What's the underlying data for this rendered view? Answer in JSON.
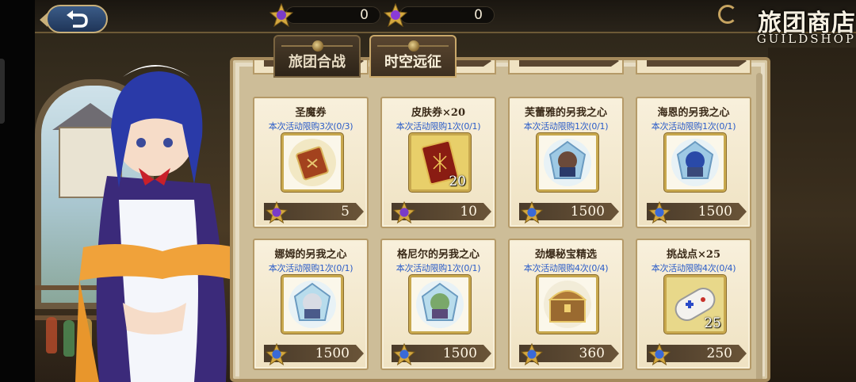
{
  "header": {
    "back_label": "↩",
    "currency": [
      {
        "icon": "purple-gold-star-gem-icon",
        "amount": "0"
      },
      {
        "icon": "purple-gold-star-gem-icon",
        "amount": "0"
      }
    ],
    "title_cn": "旅团商店",
    "title_en": "GUILDSHOP"
  },
  "tabs": [
    {
      "label": "旅团合战",
      "active": false
    },
    {
      "label": "时空远征",
      "active": true
    }
  ],
  "items": [
    {
      "name": "圣魔券",
      "limit": "本次活动限购3次(0/3)",
      "qty": "",
      "price": "5",
      "icon": "red-ticket-icon"
    },
    {
      "name": "皮肤券×20",
      "limit": "本次活动限购1次(0/1)",
      "qty": "20",
      "price": "10",
      "icon": "skin-ticket-icon"
    },
    {
      "name": "芙蕾雅的另我之心",
      "limit": "本次活动限购1次(0/1)",
      "qty": "",
      "price": "1500",
      "icon": "crystal-heart-portrait-icon"
    },
    {
      "name": "海恩的另我之心",
      "limit": "本次活动限购1次(0/1)",
      "qty": "",
      "price": "1500",
      "icon": "crystal-heart-portrait-icon"
    },
    {
      "name": "娜姆的另我之心",
      "limit": "本次活动限购1次(0/1)",
      "qty": "",
      "price": "1500",
      "icon": "crystal-heart-portrait-icon"
    },
    {
      "name": "格尼尔的另我之心",
      "limit": "本次活动限购1次(0/1)",
      "qty": "",
      "price": "1500",
      "icon": "crystal-heart-portrait-icon"
    },
    {
      "name": "劲爆秘宝精选",
      "limit": "本次活动限购4次(0/4)",
      "qty": "",
      "price": "360",
      "icon": "treasure-chest-icon"
    },
    {
      "name": "挑战点×25",
      "limit": "本次活动限购4次(0/4)",
      "qty": "25",
      "price": "250",
      "icon": "game-controller-icon"
    }
  ],
  "colors": {
    "limit_text": "#2a5cc8",
    "price_bar": "#4a3b2a",
    "card_bg": "#f8f0dc",
    "panel_bg": "#e6dcc4"
  }
}
